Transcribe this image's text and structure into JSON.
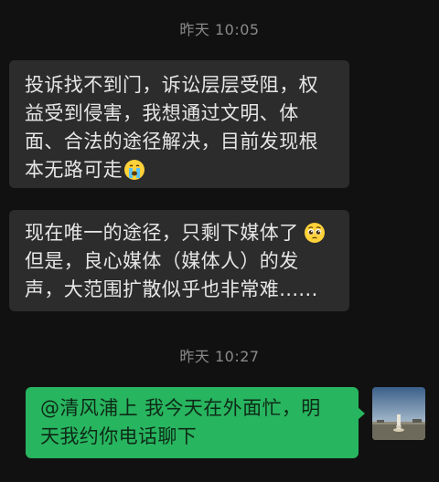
{
  "messages": [
    {
      "type": "timestamp",
      "text": "昨天 10:05"
    },
    {
      "type": "incoming",
      "lines": [
        "投诉找不到门，诉讼层层受阻，权",
        "益受到侵害，我想通过文明、体",
        "面、合法的途径解决，目前发现根",
        "本无路可走"
      ],
      "emoji": "crying-face-emoji"
    },
    {
      "type": "incoming",
      "lines": [
        "现在唯一的途径，只剩下媒体了",
        "但是，良心媒体（媒体人）的发",
        "声，大范围扩散似乎也非常难......"
      ],
      "emoji": "pleading-face-emoji"
    },
    {
      "type": "timestamp",
      "text": "昨天 10:27"
    },
    {
      "type": "outgoing",
      "lines": [
        "@清风浦上 我今天在外面忙，明",
        "天我约你电话聊下"
      ]
    }
  ],
  "colors": {
    "background": "#111111",
    "incoming_bubble": "#2c2c2c",
    "outgoing_bubble": "#28b55f",
    "timestamp_text": "#8a8a8a"
  },
  "avatar": {
    "icon": "user-avatar-image"
  }
}
